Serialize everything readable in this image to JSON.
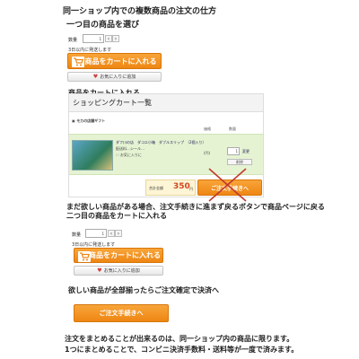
{
  "heading": "同一ショップ内での複数商品の注文の仕方",
  "step1": {
    "title": "一つ目の商品を選び",
    "qty_label": "数量",
    "qty_value": "1",
    "stock_note": "3日以内に発送します",
    "cart_button": "商品をカートに入れる",
    "fav_button": "お気に入りに追加"
  },
  "step2": {
    "title": "商品をカートに入れる",
    "cart_title": "ショッピングカート一覧",
    "shop_name": "モカの店舗ギフト",
    "col_price": "価格",
    "col_qty": "数量",
    "item_name": "ダフ川の店　ダコエ小箱　ダブルスリップ　（2個入り）",
    "item_sub": "配送料…シール…",
    "item_fav": "お気に入りに",
    "item_price": "(円)",
    "item_qty": "1",
    "change_link": "変更",
    "delete_link": "削除",
    "total_label": "合計金額",
    "total_value": "350",
    "total_unit": "円",
    "checkout_button": "ご注文手続きへ"
  },
  "step3": {
    "line1": "まだ欲しい商品がある場合、注文手続きに進まず戻るボタンで商品ページに戻る",
    "line2": "二つ目の商品をカートに入れる",
    "qty_label": "数量",
    "qty_value": "1",
    "stock_note": "3日以内に発送します",
    "cart_button": "商品をカートに入れる",
    "fav_button": "お気に入りに追加"
  },
  "step4": {
    "title": "欲しい商品が全部揃ったらご注文確定で決済へ",
    "checkout_button": "ご注文手続きへ"
  },
  "footer": {
    "line1": "注文をまとめることが出来るのは、同一ショップ内の商品に限ります。",
    "line2": "1つにまとめることで、コンビニ決済手数料・送料等が一度で済みます。"
  },
  "colors": {
    "orange": "#f39a24",
    "green_row": "#e5f3d3",
    "cross": "#c0392b"
  }
}
